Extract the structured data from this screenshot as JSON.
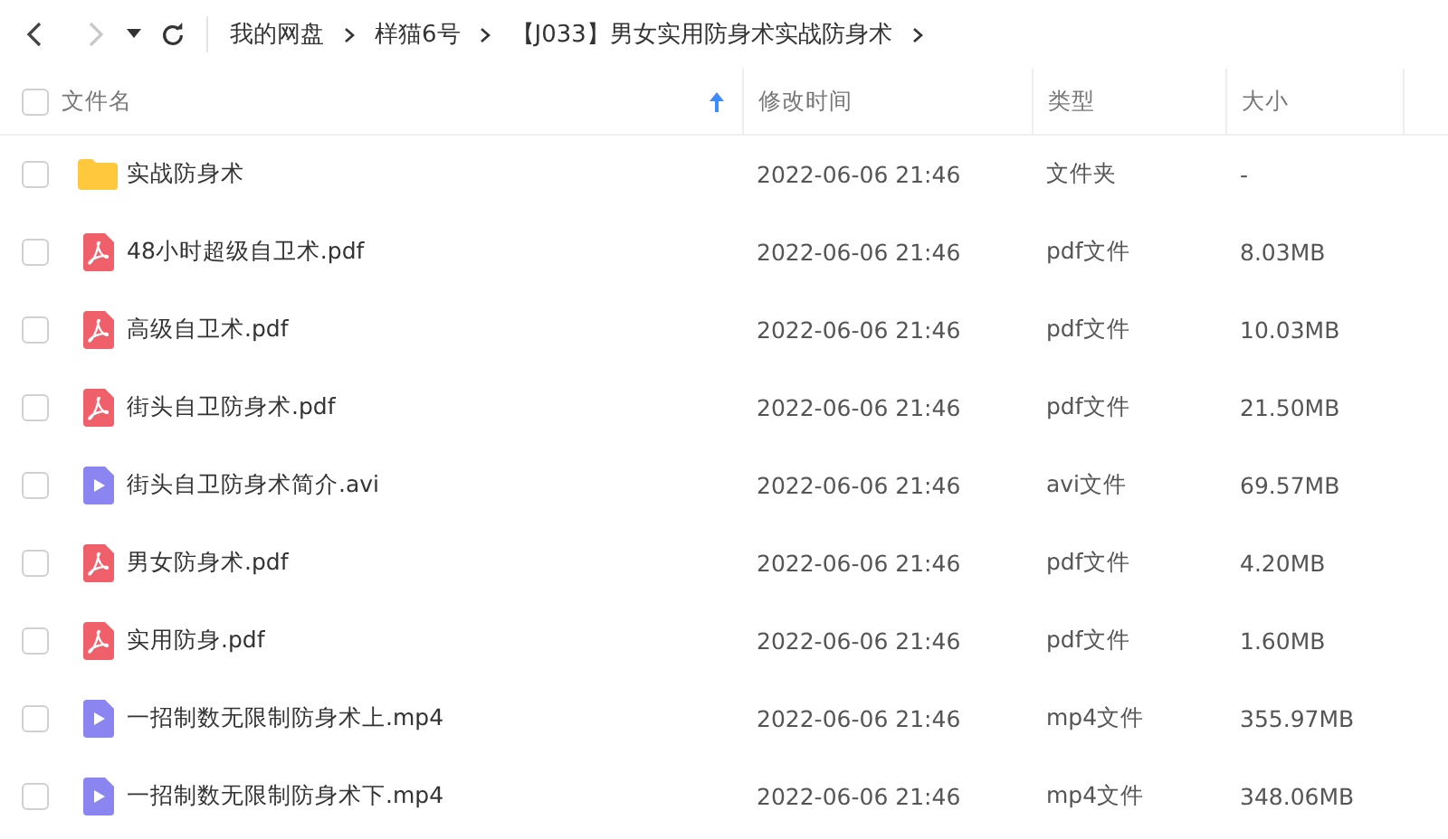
{
  "nav": {
    "back_disabled": false,
    "forward_disabled": true
  },
  "breadcrumb": [
    "我的网盘",
    "样猫6号",
    "【J033】男女实用防身术实战防身术"
  ],
  "table": {
    "select_all_checked": false,
    "columns": [
      {
        "label": "文件名",
        "sorted": true
      },
      {
        "label": "修改时间",
        "sorted": false
      },
      {
        "label": "类型",
        "sorted": false
      },
      {
        "label": "大小",
        "sorted": false
      }
    ],
    "rows": [
      {
        "kind": "folder",
        "name": "实战防身术",
        "modified": "2022-06-06 21:46",
        "type": "文件夹",
        "size": "-",
        "checked": false
      },
      {
        "kind": "pdf",
        "name": "48小时超级自卫术.pdf",
        "modified": "2022-06-06 21:46",
        "type": "pdf文件",
        "size": "8.03MB",
        "checked": false
      },
      {
        "kind": "pdf",
        "name": "高级自卫术.pdf",
        "modified": "2022-06-06 21:46",
        "type": "pdf文件",
        "size": "10.03MB",
        "checked": false
      },
      {
        "kind": "pdf",
        "name": "街头自卫防身术.pdf",
        "modified": "2022-06-06 21:46",
        "type": "pdf文件",
        "size": "21.50MB",
        "checked": false
      },
      {
        "kind": "video",
        "name": "街头自卫防身术简介.avi",
        "modified": "2022-06-06 21:46",
        "type": "avi文件",
        "size": "69.57MB",
        "checked": false
      },
      {
        "kind": "pdf",
        "name": "男女防身术.pdf",
        "modified": "2022-06-06 21:46",
        "type": "pdf文件",
        "size": "4.20MB",
        "checked": false
      },
      {
        "kind": "pdf",
        "name": "实用防身.pdf",
        "modified": "2022-06-06 21:46",
        "type": "pdf文件",
        "size": "1.60MB",
        "checked": false
      },
      {
        "kind": "video",
        "name": "一招制数无限制防身术上.mp4",
        "modified": "2022-06-06 21:46",
        "type": "mp4文件",
        "size": "355.97MB",
        "checked": false
      },
      {
        "kind": "video",
        "name": "一招制数无限制防身术下.mp4",
        "modified": "2022-06-06 21:46",
        "type": "mp4文件",
        "size": "348.06MB",
        "checked": false
      }
    ]
  }
}
